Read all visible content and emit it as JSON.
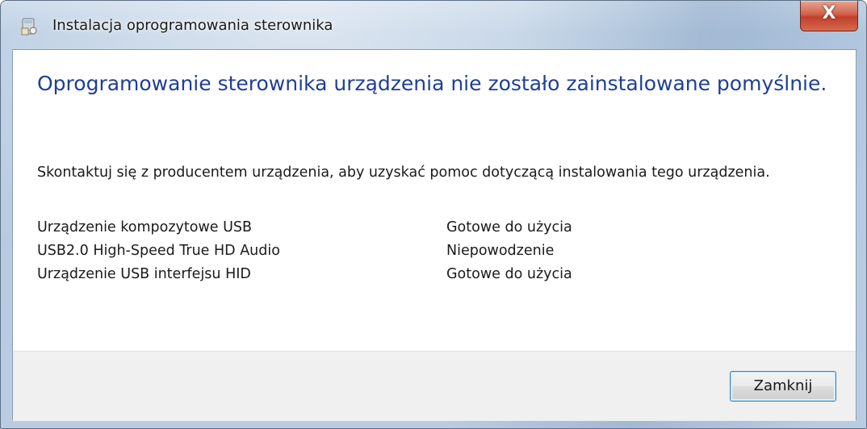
{
  "window": {
    "title": "Instalacja oprogramowania sterownika",
    "icon": "driver-install-icon",
    "close_glyph": "X"
  },
  "content": {
    "heading": "Oprogramowanie sterownika urządzenia nie zostało zainstalowane pomyślnie.",
    "message": "Skontaktuj się z producentem urządzenia, aby uzyskać pomoc dotyczącą instalowania tego urządzenia.",
    "devices": [
      {
        "name": "Urządzenie kompozytowe USB",
        "status": "Gotowe do użycia"
      },
      {
        "name": "USB2.0 High-Speed True HD Audio",
        "status": "Niepowodzenie"
      },
      {
        "name": "Urządzenie USB interfejsu HID",
        "status": "Gotowe do użycia"
      }
    ]
  },
  "footer": {
    "close_label": "Zamknij"
  },
  "colors": {
    "heading": "#1e3f96",
    "titlebar": "#b9cce2",
    "close_button_red": "#c0402a",
    "footer_bg": "#f0f0f0"
  }
}
